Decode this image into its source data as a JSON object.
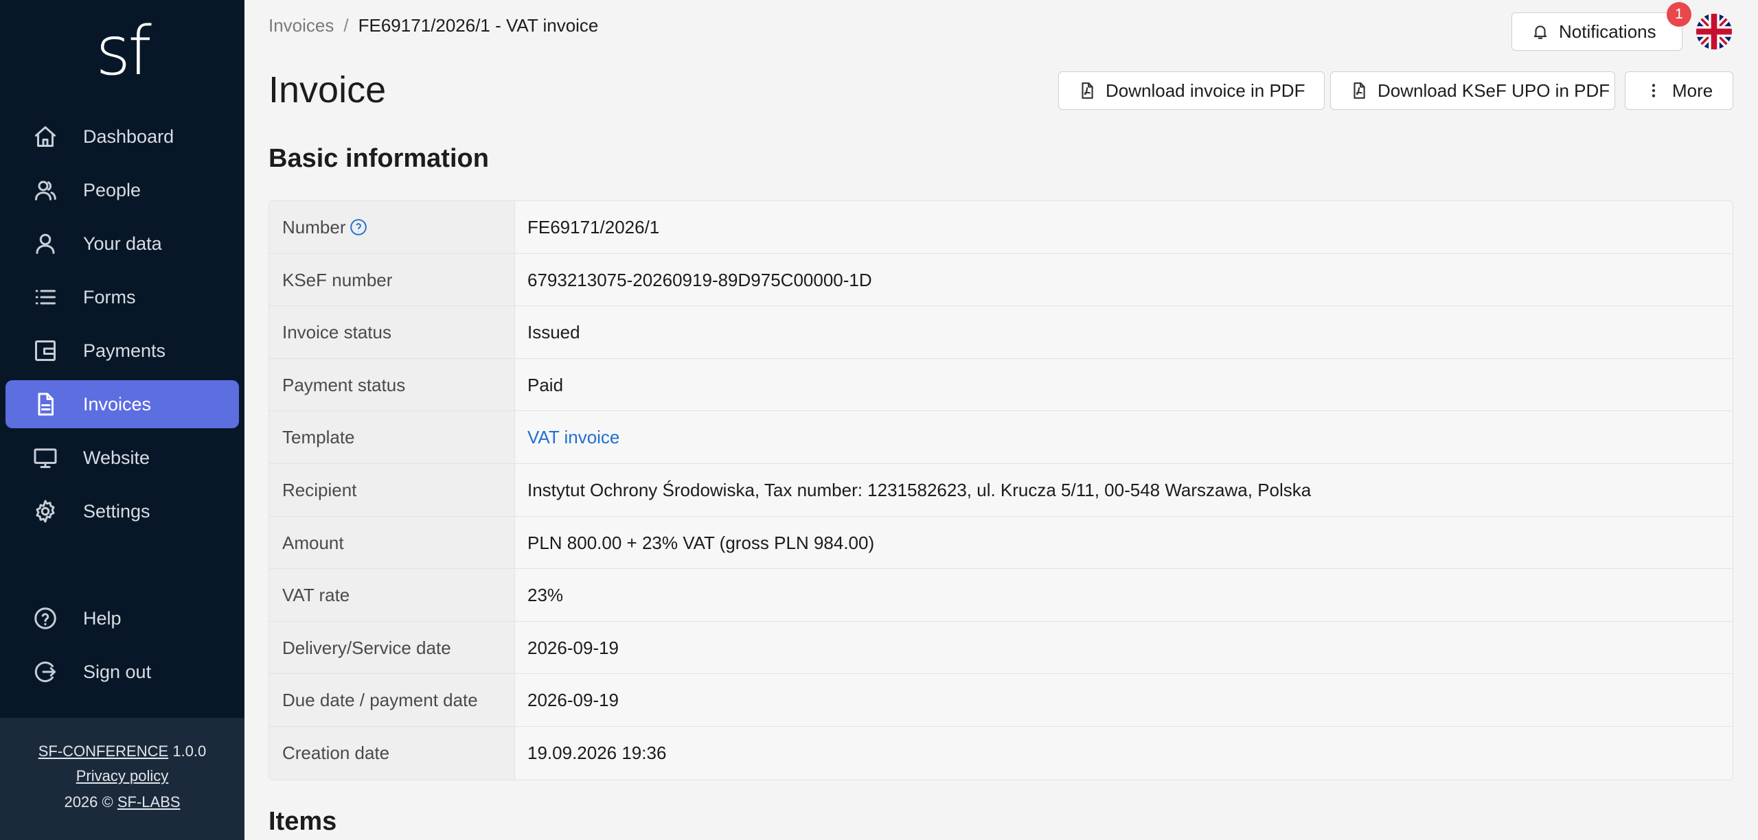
{
  "app": {
    "logo": "sf"
  },
  "sidebar": {
    "items": [
      {
        "label": "Dashboard",
        "icon": "home-icon"
      },
      {
        "label": "People",
        "icon": "people-icon"
      },
      {
        "label": "Your data",
        "icon": "user-icon"
      },
      {
        "label": "Forms",
        "icon": "list-icon"
      },
      {
        "label": "Payments",
        "icon": "wallet-icon"
      },
      {
        "label": "Invoices",
        "icon": "document-icon",
        "active": true
      },
      {
        "label": "Website",
        "icon": "monitor-icon"
      },
      {
        "label": "Settings",
        "icon": "gear-icon"
      },
      {
        "label": "Help",
        "icon": "help-circle-icon"
      },
      {
        "label": "Sign out",
        "icon": "sign-out-icon"
      }
    ],
    "footer": {
      "product_link": "SF-CONFERENCE",
      "version": "1.0.0",
      "privacy": "Privacy policy",
      "copyright": "2026 ©",
      "company_link": "SF-LABS"
    }
  },
  "header": {
    "breadcrumb": [
      "Invoices",
      "FE69171/2026/1 - VAT invoice"
    ],
    "breadcrumb_sep": "/",
    "notifications_label": "Notifications",
    "notifications_count": "1",
    "language": "English (UK flag)"
  },
  "page": {
    "title": "Invoice",
    "actions": {
      "download_pdf": "Download invoice in PDF",
      "download_upo": "Download KSeF UPO in PDF",
      "more": "More"
    }
  },
  "basic_info": {
    "title": "Basic information",
    "rows": [
      {
        "key": "Number",
        "value": "FE69171/2026/1",
        "help": true
      },
      {
        "key": "KSeF number",
        "value": "6793213075-20260919-89D975C00000-1D"
      },
      {
        "key": "Invoice status",
        "value": "Issued"
      },
      {
        "key": "Payment status",
        "value": "Paid"
      },
      {
        "key": "Template",
        "value": "VAT invoice",
        "link": true
      },
      {
        "key": "Recipient",
        "value": "Instytut Ochrony Środowiska, Tax number: 1231582623, ul. Krucza 5/11, 00-548 Warszawa, Polska"
      },
      {
        "key": "Amount",
        "value": "PLN 800.00 + 23% VAT (gross PLN 984.00)"
      },
      {
        "key": "VAT rate",
        "value": "23%"
      },
      {
        "key": "Delivery/Service date",
        "value": "2026-09-19"
      },
      {
        "key": "Due date / payment date",
        "value": "2026-09-19"
      },
      {
        "key": "Creation date",
        "value": "19.09.2026 19:36"
      }
    ]
  },
  "items_section": {
    "title": "Items"
  },
  "colors": {
    "sidebar_bg": "#081727",
    "active_item": "#5c6ee0",
    "link": "#1f6fd1",
    "badge": "#e8474c"
  }
}
